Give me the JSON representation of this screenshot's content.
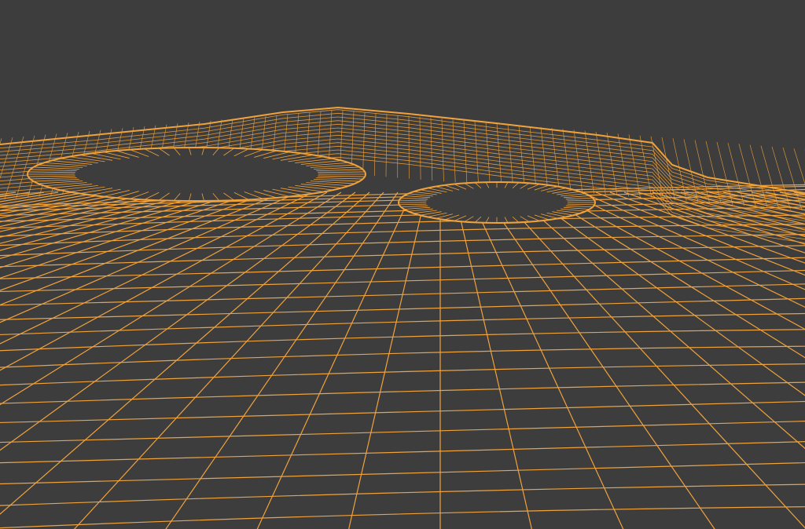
{
  "viewport": {
    "mode": "wireframe",
    "background_color": "#3d3d3d",
    "wire_color": "#f0a23c",
    "object": "subdivided-terrain-plane",
    "features": [
      "raised-plateau",
      "large-crater",
      "small-crater"
    ]
  }
}
